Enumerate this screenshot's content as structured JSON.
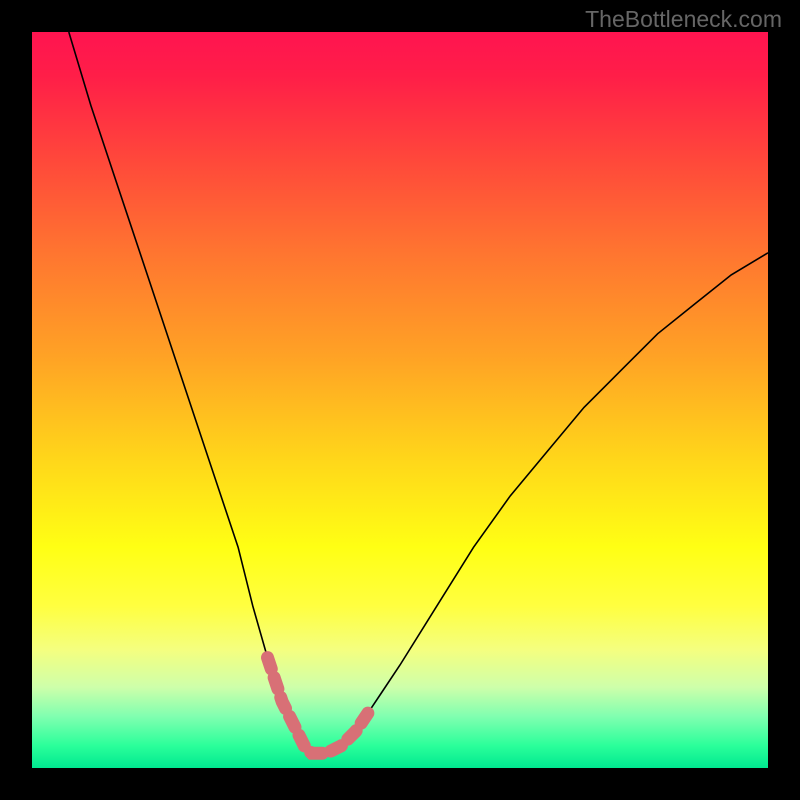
{
  "watermark": "TheBottleneck.com",
  "chart_data": {
    "type": "line",
    "title": "",
    "xlabel": "",
    "ylabel": "",
    "xlim": [
      0,
      100
    ],
    "ylim": [
      0,
      100
    ],
    "series": [
      {
        "name": "bottleneck-curve",
        "x": [
          5,
          8,
          12,
          16,
          20,
          24,
          28,
          30,
          32,
          34,
          36,
          37,
          38,
          39,
          40,
          42,
          44,
          46,
          50,
          55,
          60,
          65,
          70,
          75,
          80,
          85,
          90,
          95,
          100
        ],
        "y": [
          100,
          90,
          78,
          66,
          54,
          42,
          30,
          22,
          15,
          9,
          5,
          3,
          2,
          2,
          2,
          3,
          5,
          8,
          14,
          22,
          30,
          37,
          43,
          49,
          54,
          59,
          63,
          67,
          70
        ]
      }
    ],
    "highlight_region": {
      "name": "optimal-zone",
      "x_start": 31,
      "x_end": 48,
      "color": "#d87076"
    },
    "gradient_stops": [
      {
        "pos": 0,
        "color": "#ff1450"
      },
      {
        "pos": 70,
        "color": "#ffff14"
      },
      {
        "pos": 100,
        "color": "#00e890"
      }
    ]
  }
}
